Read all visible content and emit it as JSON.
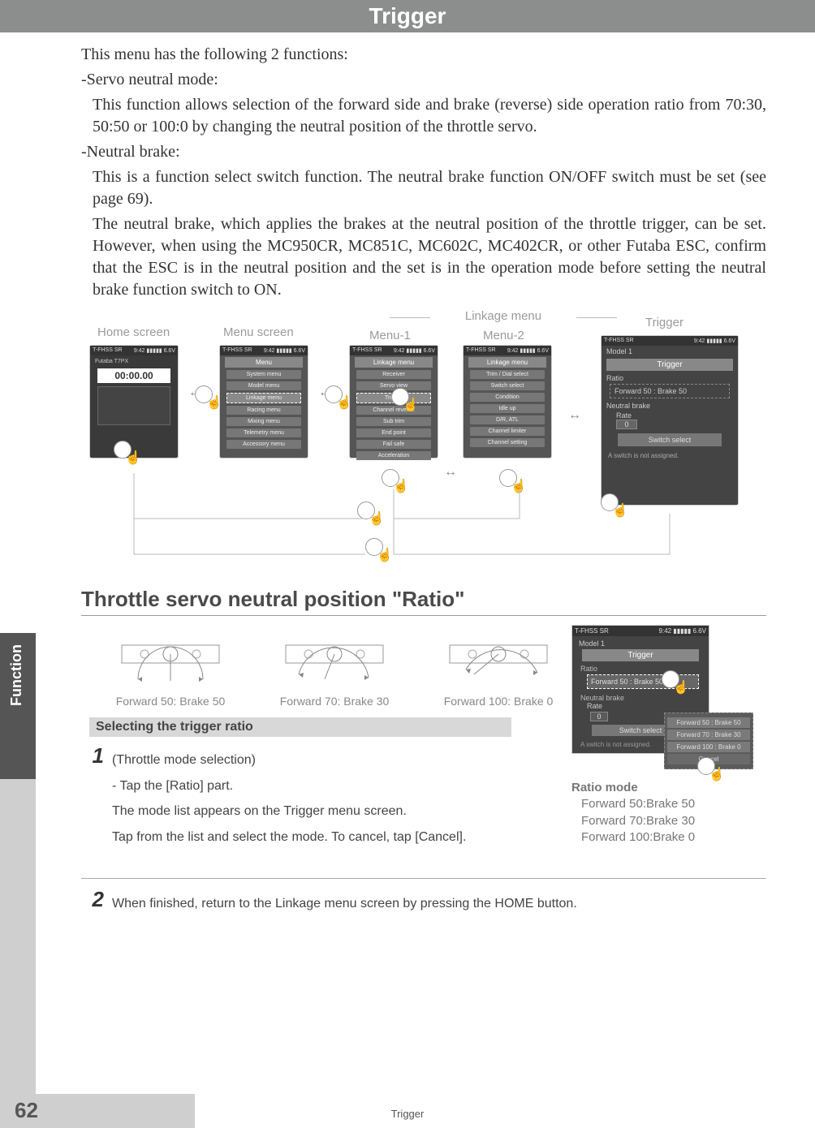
{
  "header": {
    "title": "Trigger"
  },
  "intro": {
    "line1": "This menu has the following 2 functions:",
    "servo_label": "-Servo neutral mode:",
    "servo_desc": "This function allows selection of the forward side and brake (reverse) side operation ratio from 70:30, 50:50 or 100:0 by changing the neutral position of the throttle servo.",
    "neutral_label": "-Neutral brake:",
    "neutral_desc1": "This is a function select switch function. The neutral brake function ON/OFF switch must be set (see page 69).",
    "neutral_desc2": "The neutral brake, which applies the brakes at the neutral position of the throttle trigger, can be set. However, when using the MC950CR, MC851C, MC602C, MC402CR, or other Futaba ESC, confirm that the ESC is in the neutral position and the set is in the operation mode before setting the neutral brake function switch to ON."
  },
  "nav": {
    "home_label": "Home screen",
    "menu_label": "Menu screen",
    "linkage_label": "Linkage menu",
    "menu1_label": "Menu-1",
    "menu2_label": "Menu-2",
    "trigger_label": "Trigger",
    "status_left": "T-FHSS SR",
    "status_right": "9:42  ▮▮▮▮▮ 6.6V",
    "model": "Model 1",
    "home_timer": "00:00.00",
    "menu_title": "Menu",
    "menu_items": [
      "System menu",
      "Model menu",
      "Linkage menu",
      "Racing menu",
      "Mixing menu",
      "Telemetry menu",
      "Accessory menu"
    ],
    "linkage_title": "Linkage menu",
    "m1_items": [
      "Receiver",
      "Servo view",
      "Trigger",
      "Channel reverse",
      "Sub trim",
      "End point",
      "Fail safe",
      "Acceleration"
    ],
    "m2_items": [
      "Trim / Dial select",
      "Switch select",
      "Condition",
      "Idle up",
      "D/R, ATL",
      "Channel limiter",
      "Channel setting"
    ],
    "trig_title": "Trigger",
    "trig_ratio_label": "Ratio",
    "trig_ratio_value": "Forward 50 : Brake 50",
    "trig_nb_label": "Neutral brake",
    "trig_rate_label": "Rate",
    "trig_rate_value": "0",
    "trig_switch_btn": "Switch select",
    "trig_note": "A switch is not assigned."
  },
  "section": {
    "heading_pre": "Throttle servo neutral position ",
    "heading_q": "\"Ratio\""
  },
  "ratios": {
    "r1": "Forward 50: Brake 50",
    "r2": "Forward 70: Brake 30",
    "r3": "Forward 100: Brake 0"
  },
  "sub_heading": "Selecting the trigger ratio",
  "step1": {
    "num": "1",
    "title": "(Throttle mode selection)",
    "l1": "- Tap the [Ratio] part.",
    "l2": "The mode list appears on the Trigger menu screen.",
    "l3": "Tap from the list and select the mode. To cancel, tap [Cancel]."
  },
  "popup": {
    "o1": "Forward 50 : Brake 50",
    "o2": "Forward 70 : Brake 30",
    "o3": "Forward 100 : Brake 0",
    "cancel": "Cancel"
  },
  "ratio_mode": {
    "title": "Ratio mode",
    "m1": "Forward 50:Brake 50",
    "m2": "Forward 70:Brake 30",
    "m3": "Forward 100:Brake 0"
  },
  "step2": {
    "num": "2",
    "text": "When finished, return to the Linkage menu screen by pressing the HOME button."
  },
  "footer": {
    "page": "62",
    "label": "Trigger"
  },
  "side_tab": "Function"
}
